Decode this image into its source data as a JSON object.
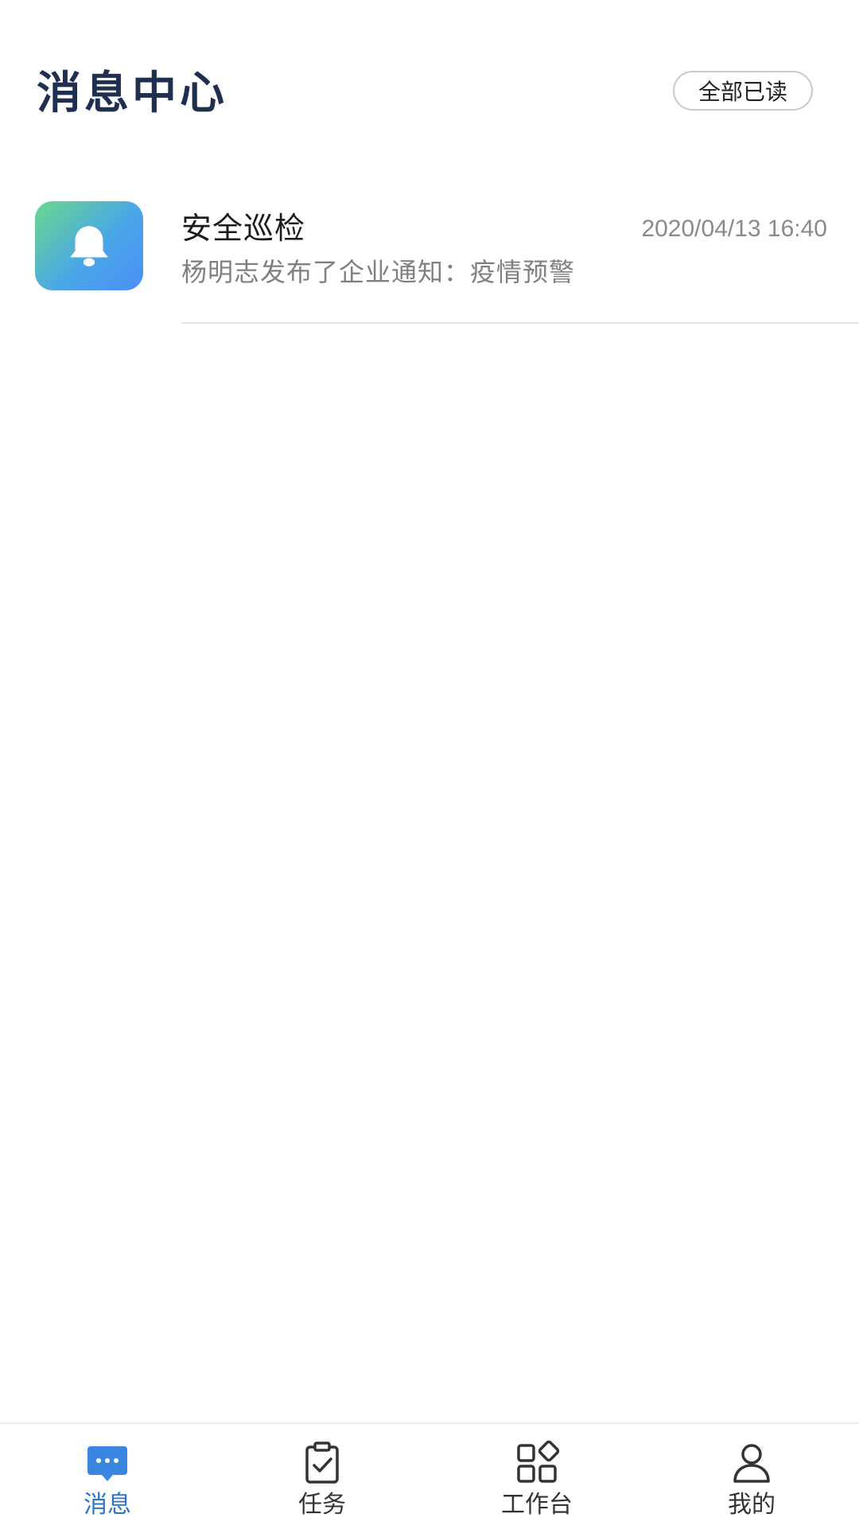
{
  "header": {
    "title": "消息中心",
    "mark_all_read_label": "全部已读"
  },
  "messages": [
    {
      "icon": "bell-icon",
      "title": "安全巡检",
      "time": "2020/04/13 16:40",
      "preview": "杨明志发布了企业通知：疫情预警"
    }
  ],
  "tabs": [
    {
      "label": "消息",
      "icon": "chat-bubble-icon",
      "active": true
    },
    {
      "label": "任务",
      "icon": "clipboard-check-icon",
      "active": false
    },
    {
      "label": "工作台",
      "icon": "apps-grid-icon",
      "active": false
    },
    {
      "label": "我的",
      "icon": "user-icon",
      "active": false
    }
  ],
  "colors": {
    "title": "#1f2f4f",
    "active_tab": "#2a74c8",
    "icon_gradient_start": "#6ad88e",
    "icon_gradient_end": "#4a8ff6"
  }
}
